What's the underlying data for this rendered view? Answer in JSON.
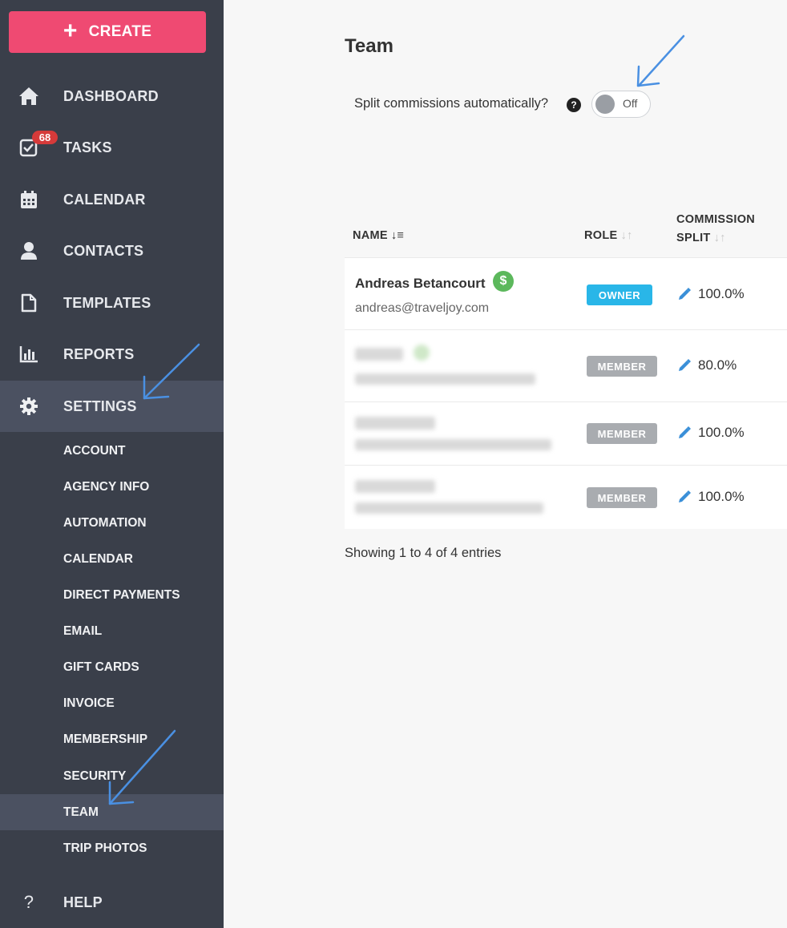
{
  "sidebar": {
    "create_label": "CREATE",
    "nav": [
      {
        "label": "DASHBOARD",
        "icon": "home-icon"
      },
      {
        "label": "TASKS",
        "icon": "task-check-icon"
      },
      {
        "label": "CALENDAR",
        "icon": "calendar-icon"
      },
      {
        "label": "CONTACTS",
        "icon": "person-icon"
      },
      {
        "label": "TEMPLATES",
        "icon": "document-icon"
      },
      {
        "label": "REPORTS",
        "icon": "bar-chart-icon"
      },
      {
        "label": "SETTINGS",
        "icon": "gear-icon"
      }
    ],
    "tasks_badge": "68",
    "settings_sub": [
      "ACCOUNT",
      "AGENCY INFO",
      "AUTOMATION",
      "CALENDAR",
      "DIRECT PAYMENTS",
      "EMAIL",
      "GIFT CARDS",
      "INVOICE",
      "MEMBERSHIP",
      "SECURITY",
      "TEAM",
      "TRIP PHOTOS"
    ],
    "help_label": "HELP"
  },
  "main": {
    "title": "Team",
    "split_label": "Split commissions automatically?",
    "toggle_state": "Off",
    "columns": {
      "name": "NAME",
      "role": "ROLE",
      "commission_line1": "COMMISSION",
      "commission_line2": "SPLIT"
    },
    "rows": [
      {
        "name": "Andreas Betancourt",
        "email": "andreas@traveljoy.com",
        "role": "OWNER",
        "split": "100.0%"
      },
      {
        "name": "",
        "email": "",
        "role": "MEMBER",
        "split": "80.0%"
      },
      {
        "name": "",
        "email": "",
        "role": "MEMBER",
        "split": "100.0%"
      },
      {
        "name": "",
        "email": "",
        "role": "MEMBER",
        "split": "100.0%"
      }
    ],
    "entries_text": "Showing 1 to 4 of 4 entries"
  },
  "colors": {
    "sidebar": "#3a3f4a",
    "create": "#ef4a72",
    "owner": "#29b6e8",
    "member": "#a9acb0",
    "annotation": "#4a90e2"
  }
}
